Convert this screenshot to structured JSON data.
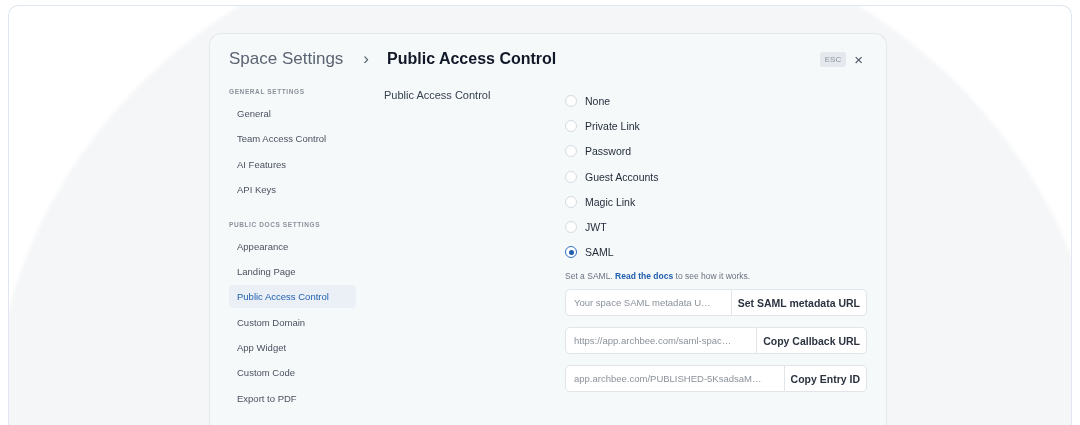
{
  "header": {
    "breadcrumb": "Space Settings",
    "separator": "›",
    "title": "Public Access Control",
    "esc_badge": "ESC",
    "close": "×"
  },
  "sidebar": {
    "groups": [
      {
        "heading": "GENERAL SETTINGS",
        "items": [
          {
            "label": "General",
            "selected": false
          },
          {
            "label": "Team Access Control",
            "selected": false
          },
          {
            "label": "AI Features",
            "selected": false
          },
          {
            "label": "API Keys",
            "selected": false
          }
        ]
      },
      {
        "heading": "PUBLIC DOCS SETTINGS",
        "items": [
          {
            "label": "Appearance",
            "selected": false
          },
          {
            "label": "Landing Page",
            "selected": false
          },
          {
            "label": "Public Access Control",
            "selected": true
          },
          {
            "label": "Custom Domain",
            "selected": false
          },
          {
            "label": "App Widget",
            "selected": false
          },
          {
            "label": "Custom Code",
            "selected": false
          },
          {
            "label": "Export to PDF",
            "selected": false
          }
        ]
      }
    ]
  },
  "content": {
    "label": "Public Access Control",
    "options": [
      {
        "label": "None",
        "selected": false
      },
      {
        "label": "Private Link",
        "selected": false
      },
      {
        "label": "Password",
        "selected": false
      },
      {
        "label": "Guest Accounts",
        "selected": false
      },
      {
        "label": "Magic Link",
        "selected": false
      },
      {
        "label": "JWT",
        "selected": false
      },
      {
        "label": "SAML",
        "selected": true
      }
    ],
    "help": {
      "before": "Set a SAML. ",
      "link": "Read the docs",
      "after": " to see how it works."
    },
    "fields": [
      {
        "placeholder": "Your space SAML metadata U…",
        "button": "Set SAML metadata URL"
      },
      {
        "value": "https://app.archbee.com/saml-spac…",
        "button": "Copy Callback URL"
      },
      {
        "value": "app.archbee.com/PUBLISHED-5KsadsaM…",
        "button": "Copy Entry ID"
      }
    ]
  }
}
